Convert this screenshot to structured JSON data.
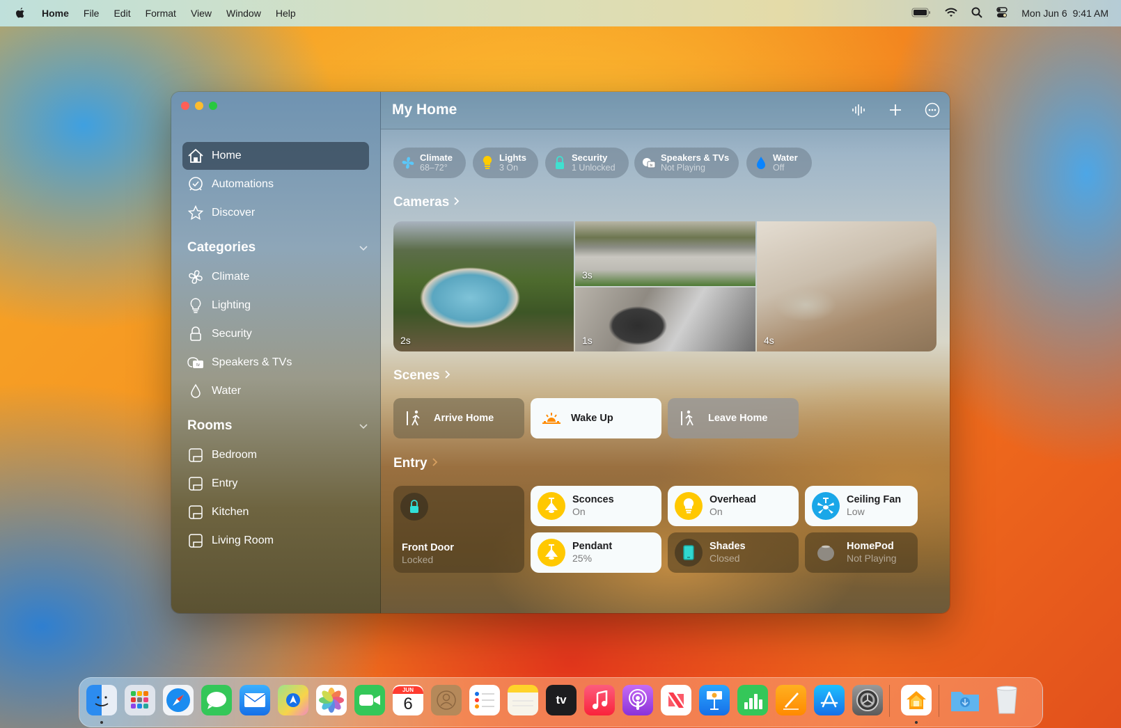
{
  "menubar": {
    "app_name": "Home",
    "items": [
      "File",
      "Edit",
      "Format",
      "View",
      "Window",
      "Help"
    ],
    "date": "Mon Jun 6",
    "time": "9:41 AM",
    "status_icons": [
      "battery-icon",
      "wifi-icon",
      "search-icon",
      "control-center-icon"
    ]
  },
  "window": {
    "title": "My Home",
    "toolbar": [
      "intercom-waveform-icon",
      "add-icon",
      "more-icon"
    ]
  },
  "sidebar": {
    "main_items": [
      {
        "label": "Home",
        "icon": "house-icon",
        "active": true
      },
      {
        "label": "Automations",
        "icon": "clock-icon",
        "active": false
      },
      {
        "label": "Discover",
        "icon": "star-icon",
        "active": false
      }
    ],
    "categories_header": "Categories",
    "categories": [
      {
        "label": "Climate",
        "icon": "fan-icon"
      },
      {
        "label": "Lighting",
        "icon": "lightbulb-icon"
      },
      {
        "label": "Security",
        "icon": "lock-icon"
      },
      {
        "label": "Speakers & TVs",
        "icon": "homepod-tv-icon"
      },
      {
        "label": "Water",
        "icon": "drop-icon"
      }
    ],
    "rooms_header": "Rooms",
    "rooms": [
      {
        "label": "Bedroom"
      },
      {
        "label": "Entry"
      },
      {
        "label": "Kitchen"
      },
      {
        "label": "Living Room"
      }
    ]
  },
  "status_pills": [
    {
      "title": "Climate",
      "status": "68–72°",
      "icon": "fan-icon",
      "color": "#5ac8fa"
    },
    {
      "title": "Lights",
      "status": "3 On",
      "icon": "lightbulb-icon",
      "color": "#ffcc00"
    },
    {
      "title": "Security",
      "status": "1 Unlocked",
      "icon": "lock-open-icon",
      "color": "#40e0d0"
    },
    {
      "title": "Speakers & TVs",
      "status": "Not Playing",
      "icon": "homepod-tv-icon",
      "color": "#ffffff"
    },
    {
      "title": "Water",
      "status": "Off",
      "icon": "drop-icon",
      "color": "#0a84ff"
    }
  ],
  "cameras": {
    "header": "Cameras",
    "feeds": [
      {
        "label": "2s",
        "scene": "pool"
      },
      {
        "label": "3s",
        "scene": "driveway"
      },
      {
        "label": "1s",
        "scene": "garage"
      },
      {
        "label": "4s",
        "scene": "living-room"
      }
    ]
  },
  "scenes": {
    "header": "Scenes",
    "items": [
      {
        "label": "Arrive Home",
        "icon": "person-arriving-icon",
        "active": false
      },
      {
        "label": "Wake Up",
        "icon": "sunrise-icon",
        "active": true
      },
      {
        "label": "Leave Home",
        "icon": "person-leaving-icon",
        "active": false
      }
    ]
  },
  "entry": {
    "header": "Entry",
    "front_door": {
      "name": "Front Door",
      "status": "Locked"
    },
    "accessories": [
      {
        "name": "Sconces",
        "status": "On",
        "on": true,
        "icon": "pendant-lamp-icon"
      },
      {
        "name": "Overhead",
        "status": "On",
        "on": true,
        "icon": "lightbulb-icon"
      },
      {
        "name": "Ceiling Fan",
        "status": "Low",
        "on": true,
        "icon": "ceiling-fan-icon"
      },
      {
        "name": "Pendant",
        "status": "25%",
        "on": true,
        "icon": "pendant-lamp-icon"
      },
      {
        "name": "Shades",
        "status": "Closed",
        "on": false,
        "icon": "shades-icon"
      },
      {
        "name": "HomePod",
        "status": "Not Playing",
        "on": false,
        "icon": "homepod-icon"
      }
    ]
  },
  "dock": {
    "apps": [
      "Finder",
      "Launchpad",
      "Safari",
      "Messages",
      "Mail",
      "Maps",
      "Photos",
      "FaceTime",
      "Calendar",
      "Contacts",
      "Reminders",
      "Notes",
      "TV",
      "Music",
      "Podcasts",
      "News",
      "Keynote",
      "Numbers",
      "Pages",
      "App Store",
      "System Settings",
      "Home",
      "Downloads",
      "Trash"
    ],
    "calendar_month": "JUN",
    "calendar_day": "6",
    "tv_label": "tv"
  }
}
